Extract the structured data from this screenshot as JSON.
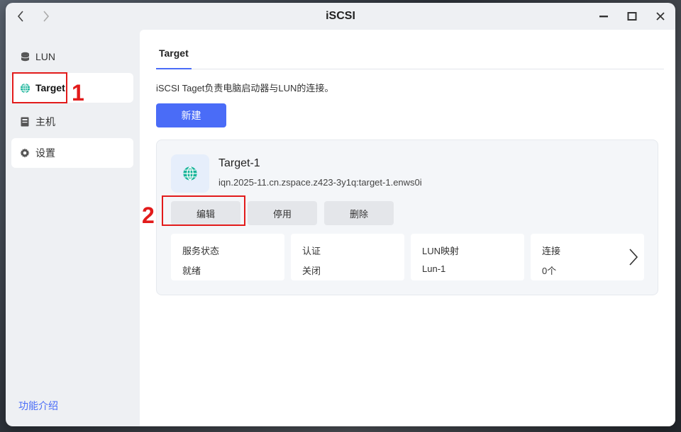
{
  "window": {
    "title": "iSCSI"
  },
  "sidebar": {
    "items": [
      {
        "label": "LUN",
        "icon": "database-icon"
      },
      {
        "label": "Target",
        "icon": "globe-icon"
      },
      {
        "label": "主机",
        "icon": "server-icon"
      },
      {
        "label": "设置",
        "icon": "gear-icon"
      }
    ],
    "help_link": "功能介绍"
  },
  "main": {
    "tabs": [
      {
        "label": "Target"
      }
    ],
    "description": "iSCSI Taget负责电脑启动器与LUN的连接。",
    "new_button": "新建",
    "target_card": {
      "name": "Target-1",
      "iqn": "iqn.2025-11.cn.zspace.z423-3y1q:target-1.enws0i",
      "actions": {
        "edit": "编辑",
        "disable": "停用",
        "delete": "删除"
      },
      "stats": [
        {
          "label": "服务状态",
          "value": "就绪"
        },
        {
          "label": "认证",
          "value": "关闭"
        },
        {
          "label": "LUN映射",
          "value": "Lun-1"
        },
        {
          "label": "连接",
          "value": "0个"
        }
      ]
    }
  },
  "annotations": {
    "step1": "1",
    "step2": "2"
  },
  "colors": {
    "accent": "#4a6cf7",
    "annotation": "#e21b1b",
    "globe": "#19b49a"
  }
}
